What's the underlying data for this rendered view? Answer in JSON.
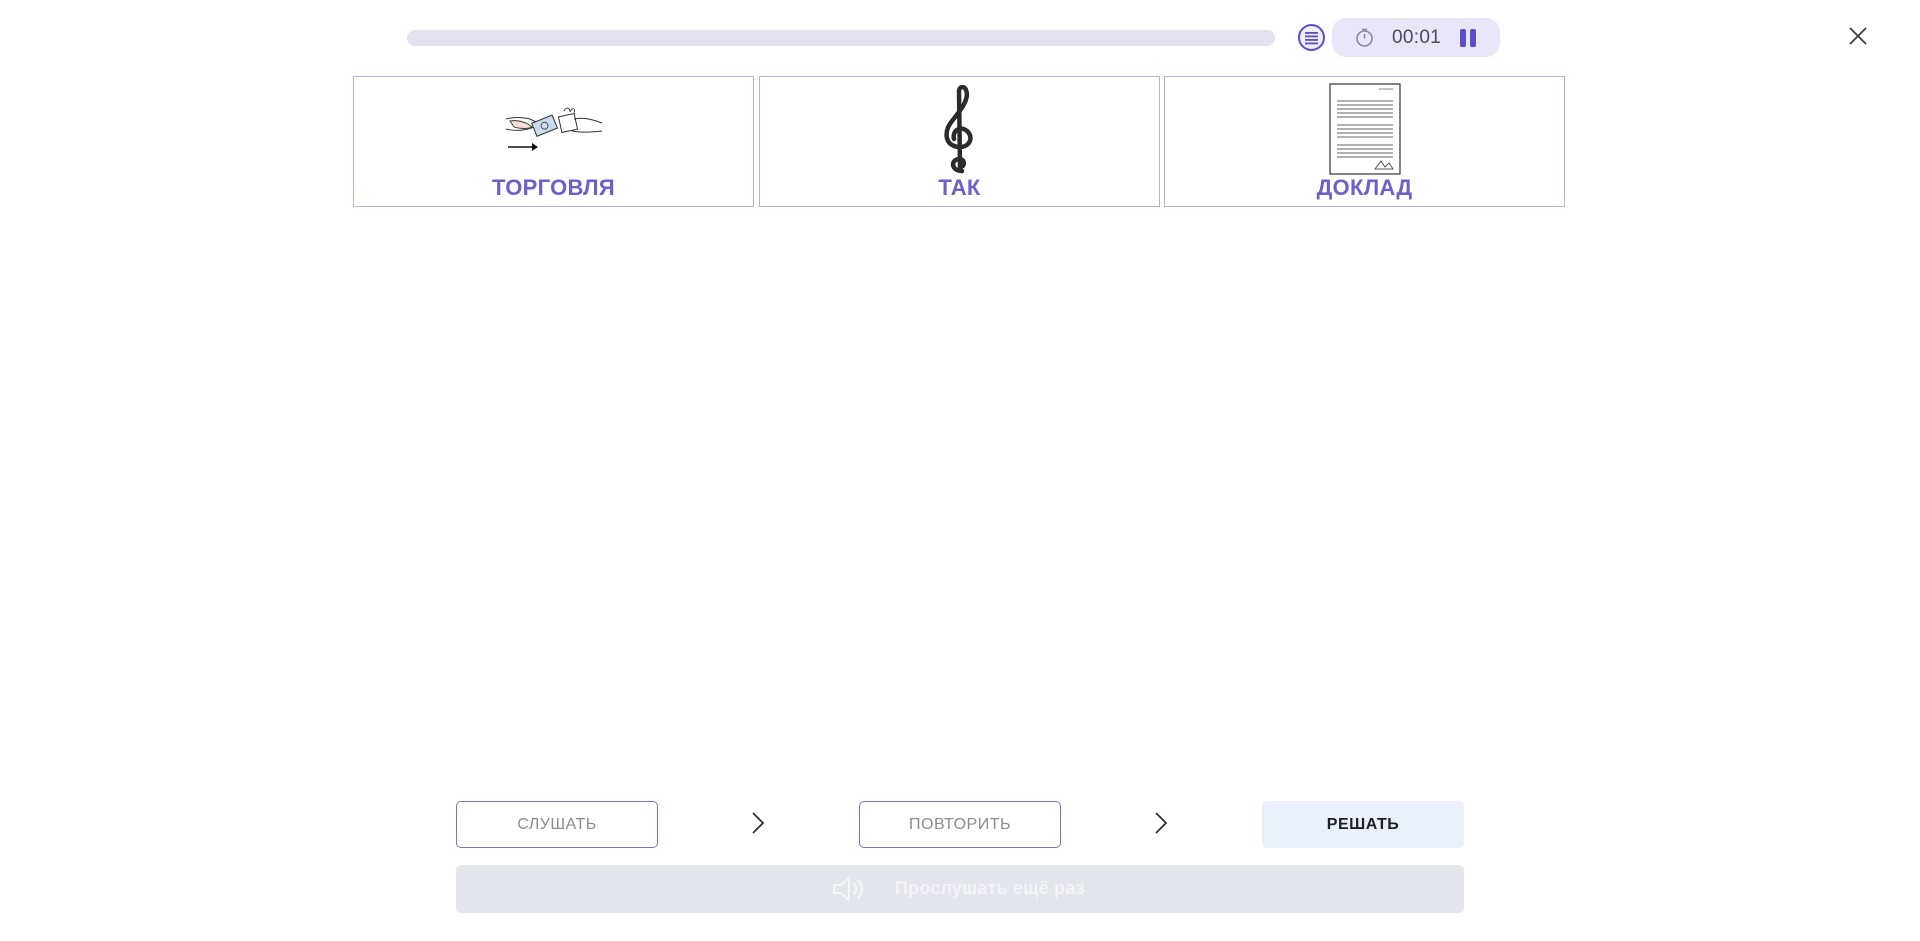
{
  "header": {
    "progress_fraction": 0,
    "list_icon": "list-icon",
    "timer": {
      "icon": "stopwatch-icon",
      "value": "00:01"
    },
    "pause_icon": "pause-icon",
    "close_icon": "close-icon"
  },
  "cards": [
    {
      "label": "ТОРГОВЛЯ",
      "icon": "trade-exchange-icon"
    },
    {
      "label": "ТАК",
      "icon": "treble-clef-icon"
    },
    {
      "label": "ДОКЛАД",
      "icon": "report-document-icon"
    }
  ],
  "steps": {
    "listen_label": "СЛУШАТЬ",
    "repeat_label": "ПОВТОРИТЬ",
    "solve_label": "РЕШАТЬ"
  },
  "replay": {
    "label": "Прослушать ещё раз",
    "icon": "speaker-icon"
  },
  "colors": {
    "accent": "#6f5fc9",
    "card_border": "#b7b0e6",
    "timer_bg": "#e8e6f7",
    "solve_bg": "#eaf0fb",
    "replay_bg": "#e3e6ec"
  }
}
